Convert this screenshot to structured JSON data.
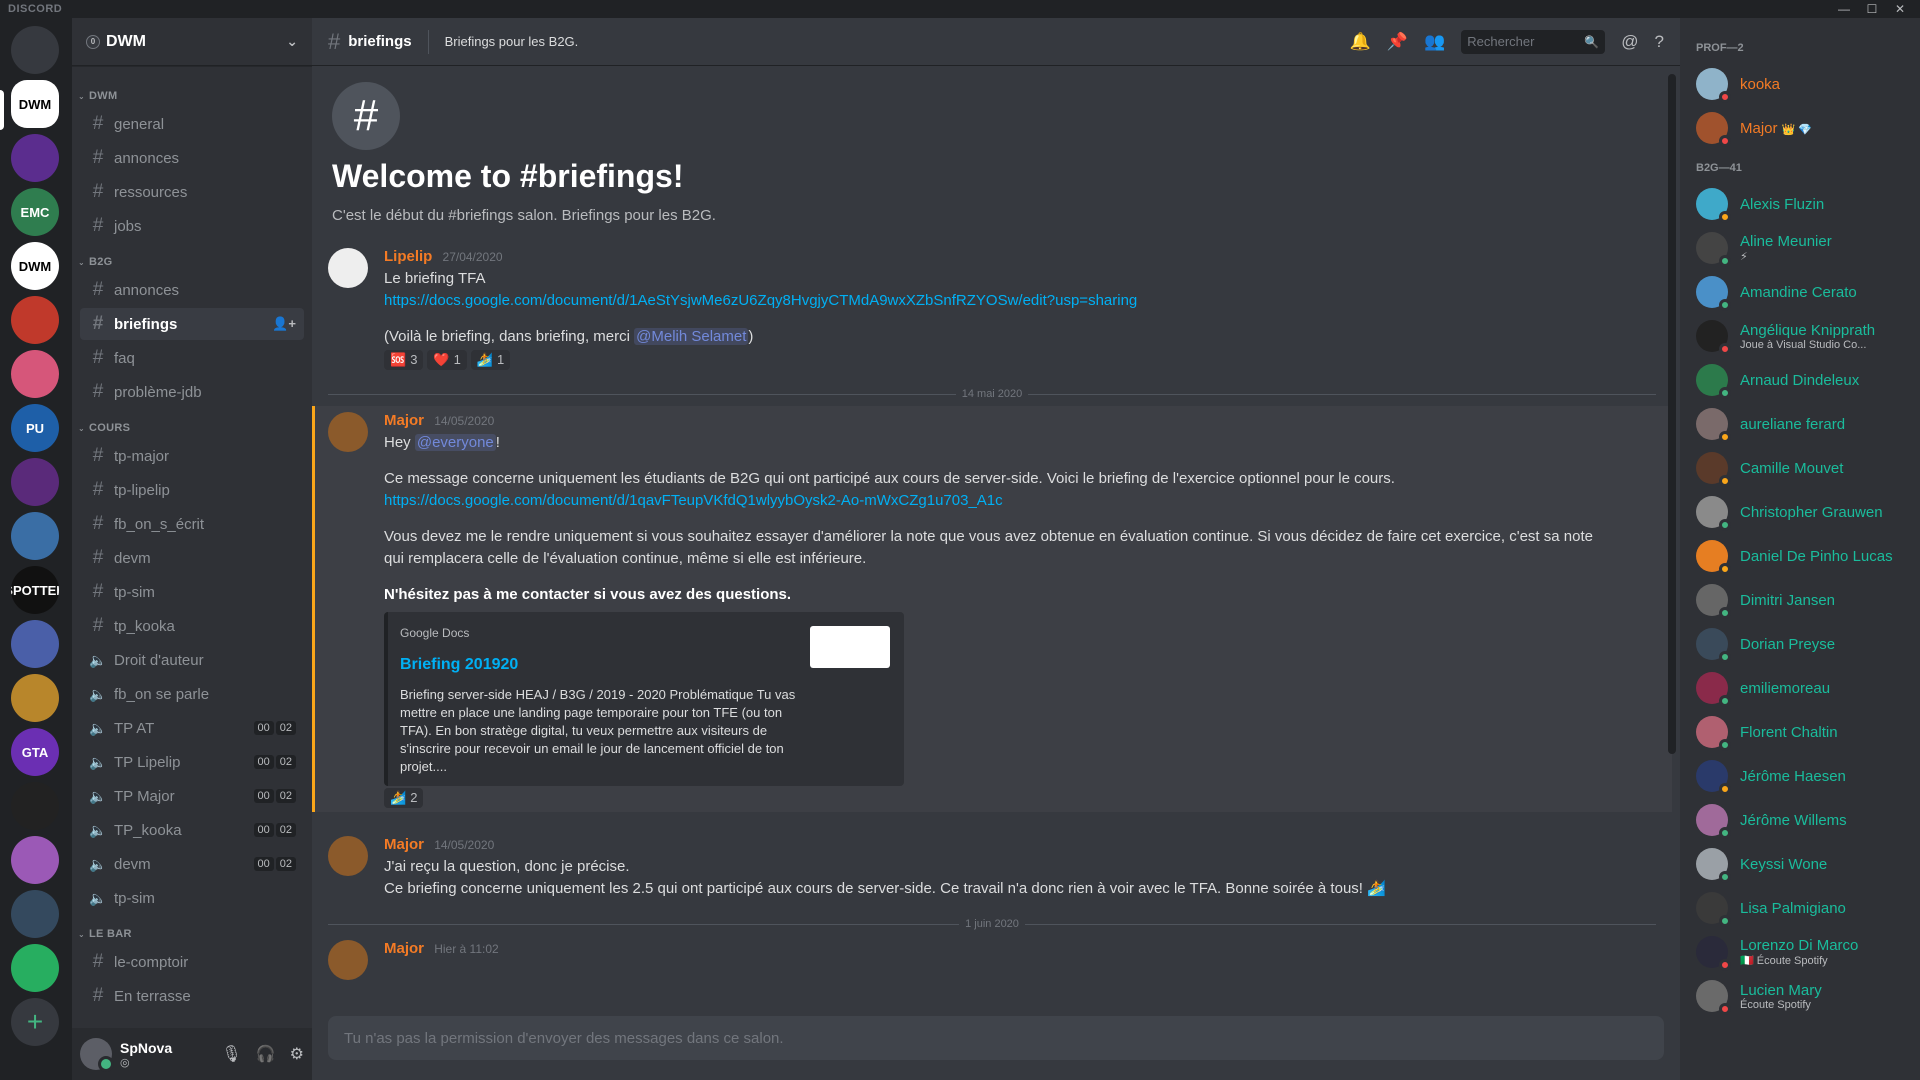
{
  "app": {
    "brand": "DISCORD"
  },
  "colors": {
    "prof": "#f47b25",
    "b2g": "#1abc9c",
    "link": "#00b0f4",
    "online": "#43b581",
    "dnd": "#f04747",
    "idle": "#faa61a"
  },
  "server": {
    "name": "DWM"
  },
  "guilds": [
    {
      "label": "",
      "bg": "#36393f"
    },
    {
      "label": "DWM",
      "bg": "#ffffff"
    },
    {
      "label": "",
      "bg": "#5b2d8e"
    },
    {
      "label": "EMC",
      "bg": "#2f7d4f"
    },
    {
      "label": "DWM",
      "bg": "#ffffff"
    },
    {
      "label": "",
      "bg": "#c0392b"
    },
    {
      "label": "",
      "bg": "#d6567a"
    },
    {
      "label": "PU",
      "bg": "#1e5fa8"
    },
    {
      "label": "",
      "bg": "#5a2a7a"
    },
    {
      "label": "",
      "bg": "#3a6ea5"
    },
    {
      "label": "SPOTTED",
      "bg": "#111111"
    },
    {
      "label": "",
      "bg": "#4a5fa8"
    },
    {
      "label": "",
      "bg": "#b8862b"
    },
    {
      "label": "GTA",
      "bg": "#6b2fb3"
    },
    {
      "label": "",
      "bg": "#222222"
    },
    {
      "label": "",
      "bg": "#9b59b6"
    },
    {
      "label": "",
      "bg": "#34495e"
    },
    {
      "label": "",
      "bg": "#27ae60"
    }
  ],
  "categories": [
    {
      "name": "DWM",
      "channels": [
        {
          "type": "text",
          "name": "general"
        },
        {
          "type": "text",
          "name": "annonces"
        },
        {
          "type": "text",
          "name": "ressources"
        },
        {
          "type": "text",
          "name": "jobs"
        }
      ]
    },
    {
      "name": "B2G",
      "channels": [
        {
          "type": "text",
          "name": "annonces"
        },
        {
          "type": "text",
          "name": "briefings",
          "active": true
        },
        {
          "type": "text",
          "name": "faq"
        },
        {
          "type": "text",
          "name": "problème-jdb"
        }
      ]
    },
    {
      "name": "COURS",
      "channels": [
        {
          "type": "text",
          "name": "tp-major"
        },
        {
          "type": "text",
          "name": "tp-lipelip"
        },
        {
          "type": "text",
          "name": "fb_on_s_écrit"
        },
        {
          "type": "text",
          "name": "devm"
        },
        {
          "type": "text",
          "name": "tp-sim"
        },
        {
          "type": "text",
          "name": "tp_kooka"
        },
        {
          "type": "voice",
          "name": "Droit d'auteur"
        },
        {
          "type": "voice",
          "name": "fb_on se parle"
        },
        {
          "type": "voice",
          "name": "TP AT",
          "counts": [
            "00",
            "02"
          ]
        },
        {
          "type": "voice",
          "name": "TP Lipelip",
          "counts": [
            "00",
            "02"
          ]
        },
        {
          "type": "voice",
          "name": "TP Major",
          "counts": [
            "00",
            "02"
          ]
        },
        {
          "type": "voice",
          "name": "TP_kooka",
          "counts": [
            "00",
            "02"
          ]
        },
        {
          "type": "voice",
          "name": "devm",
          "counts": [
            "00",
            "02"
          ]
        },
        {
          "type": "voice",
          "name": "tp-sim"
        }
      ]
    },
    {
      "name": "LE BAR",
      "channels": [
        {
          "type": "text",
          "name": "le-comptoir"
        },
        {
          "type": "text",
          "name": "En terrasse"
        }
      ]
    }
  ],
  "user": {
    "name": "SpNova"
  },
  "channel": {
    "name": "briefings",
    "topic": "Briefings pour les B2G.",
    "search_placeholder": "Rechercher",
    "welcome_title": "Welcome to #briefings!",
    "welcome_desc": "C'est le début du #briefings salon. Briefings pour les B2G."
  },
  "messages": {
    "m1": {
      "author": "Lipelip",
      "time": "27/04/2020",
      "line1": "Le briefing TFA",
      "link": "https://docs.google.com/document/d/1AeStYsjwMe6zU6Zqy8HvgjyCTMdA9wxXZbSnfRZYOSw/edit?usp=sharing",
      "line2_pre": "(Voilà le briefing, dans briefing, merci ",
      "mention": "@Melih Selamet",
      "line2_post": ")",
      "reactions": [
        {
          "emoji": "🆘",
          "count": "3"
        },
        {
          "emoji": "❤️",
          "count": "1"
        },
        {
          "emoji": "🏄",
          "count": "1"
        }
      ]
    },
    "date1": "14 mai 2020",
    "m2": {
      "author": "Major",
      "time": "14/05/2020",
      "hey": "Hey ",
      "everyone": "@everyone",
      "bang": "!",
      "p1": "Ce message concerne uniquement les étudiants de B2G qui ont participé aux cours de server-side. Voici le briefing de l'exercice optionnel pour le cours.",
      "link": "https://docs.google.com/document/d/1qavFTeupVKfdQ1wlyybOysk2-Ao-mWxCZg1u703_A1c",
      "p2": "Vous devez me le rendre uniquement si vous souhaitez essayer d'améliorer la note que vous avez obtenue en évaluation continue. Si vous décidez de faire cet exercice, c'est sa note qui remplacera celle de l'évaluation continue, même si elle est inférieure.",
      "bold": "N'hésitez pas à me contacter si vous avez des questions.",
      "embed": {
        "provider": "Google Docs",
        "title": "Briefing 201920",
        "desc": "Briefing server-side HEAJ / B3G / 2019 - 2020 Problématique Tu vas mettre en place une landing page temporaire pour ton TFE (ou ton TFA). En bon stratège digital, tu veux permettre aux visiteurs de s'inscrire pour recevoir un email le jour de lancement officiel de ton projet...."
      },
      "reactions": [
        {
          "emoji": "🏄",
          "count": "2"
        }
      ]
    },
    "m3": {
      "author": "Major",
      "time": "14/05/2020",
      "line1": "J'ai reçu la question, donc je précise.",
      "line2": "Ce briefing concerne uniquement les 2.5 qui ont participé aux cours de server-side. Ce travail n'a donc rien à voir avec le TFA.  Bonne soirée à tous! 🏄"
    },
    "date2": "1 juin 2020",
    "m4": {
      "author": "Major",
      "time": "Hier à 11:02"
    }
  },
  "composer_placeholder": "Tu n'as pas la permission d'envoyer des messages dans ce salon.",
  "member_groups": [
    {
      "title": "PROF—2",
      "role": "prof",
      "members": [
        {
          "name": "kooka",
          "status": "dnd",
          "av": "#8fb3c9"
        },
        {
          "name": "Major",
          "status": "dnd",
          "av": "#a0522d",
          "badge": "👑 💎"
        }
      ]
    },
    {
      "title": "B2G—41",
      "role": "b2g",
      "members": [
        {
          "name": "Alexis Fluzin",
          "status": "idle",
          "av": "#3fa9c9"
        },
        {
          "name": "Aline Meunier",
          "status": "online",
          "av": "#444444",
          "sub": "⚡"
        },
        {
          "name": "Amandine Cerato",
          "status": "online",
          "av": "#4a90c8"
        },
        {
          "name": "Angélique Knipprath",
          "status": "dnd",
          "av": "#222222",
          "sub": "Joue à Visual Studio Co..."
        },
        {
          "name": "Arnaud Dindeleux",
          "status": "online",
          "av": "#2c7a4b"
        },
        {
          "name": "aureliane ferard",
          "status": "idle",
          "av": "#7a6a6a"
        },
        {
          "name": "Camille Mouvet",
          "status": "idle",
          "av": "#5a3a2a"
        },
        {
          "name": "Christopher Grauwen",
          "status": "online",
          "av": "#8a8a8a"
        },
        {
          "name": "Daniel De Pinho Lucas",
          "status": "idle",
          "av": "#e67e22"
        },
        {
          "name": "Dimitri Jansen",
          "status": "online",
          "av": "#666666"
        },
        {
          "name": "Dorian Preyse",
          "status": "online",
          "av": "#3a4a5a"
        },
        {
          "name": "emiliemoreau",
          "status": "online",
          "av": "#8a2a4a"
        },
        {
          "name": "Florent Chaltin",
          "status": "online",
          "av": "#b06070"
        },
        {
          "name": "Jérôme Haesen",
          "status": "idle",
          "av": "#2a3a6a"
        },
        {
          "name": "Jérôme Willems",
          "status": "online",
          "av": "#a06a9a"
        },
        {
          "name": "Keyssi Wone",
          "status": "online",
          "av": "#9aa0a6"
        },
        {
          "name": "Lisa Palmigiano",
          "status": "online",
          "av": "#3a3a3a"
        },
        {
          "name": "Lorenzo Di Marco",
          "status": "dnd",
          "av": "#2a2a3a",
          "sub": "🇮🇹 Écoute Spotify"
        },
        {
          "name": "Lucien Mary",
          "status": "dnd",
          "av": "#6a6a6a",
          "sub": "Écoute Spotify"
        }
      ]
    }
  ]
}
